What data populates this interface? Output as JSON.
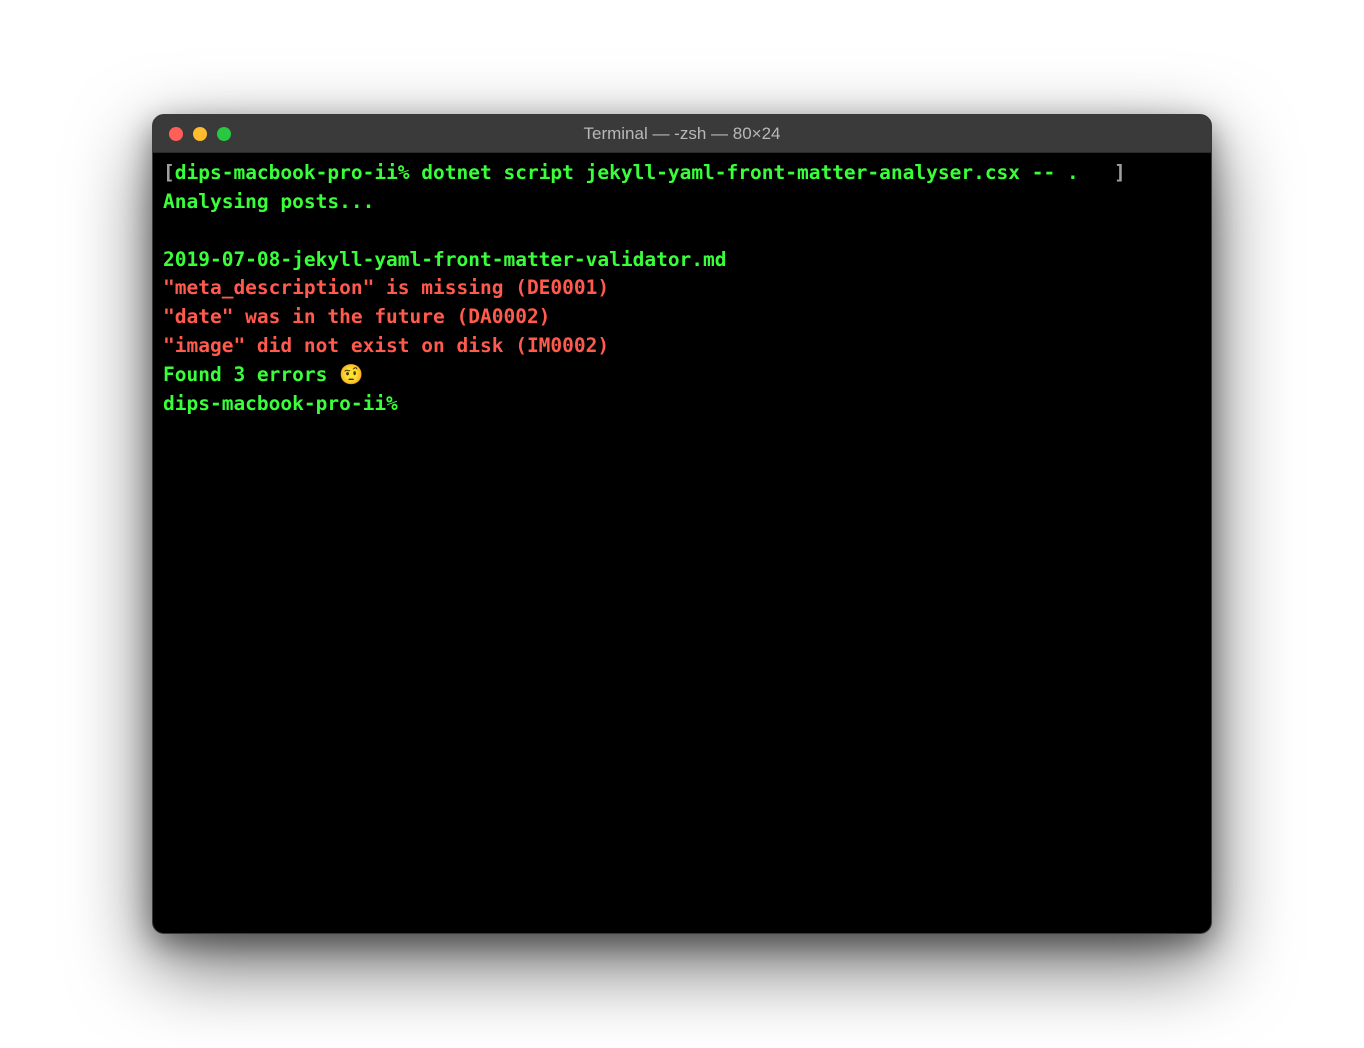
{
  "window": {
    "title": "Terminal — -zsh — 80×24"
  },
  "terminal": {
    "bracket_left": "[",
    "bracket_right": "]",
    "prompt1": "dips-macbook-pro-ii% ",
    "command": "dotnet script jekyll-yaml-front-matter-analyser.csx -- .",
    "status": "Analysing posts...",
    "filename": "2019-07-08-jekyll-yaml-front-matter-validator.md",
    "errors": [
      "\"meta_description\" is missing (DE0001)",
      "\"date\" was in the future (DA0002)",
      "\"image\" did not exist on disk (IM0002)"
    ],
    "summary": "Found 3 errors 🤨",
    "prompt2": "dips-macbook-pro-ii% "
  }
}
